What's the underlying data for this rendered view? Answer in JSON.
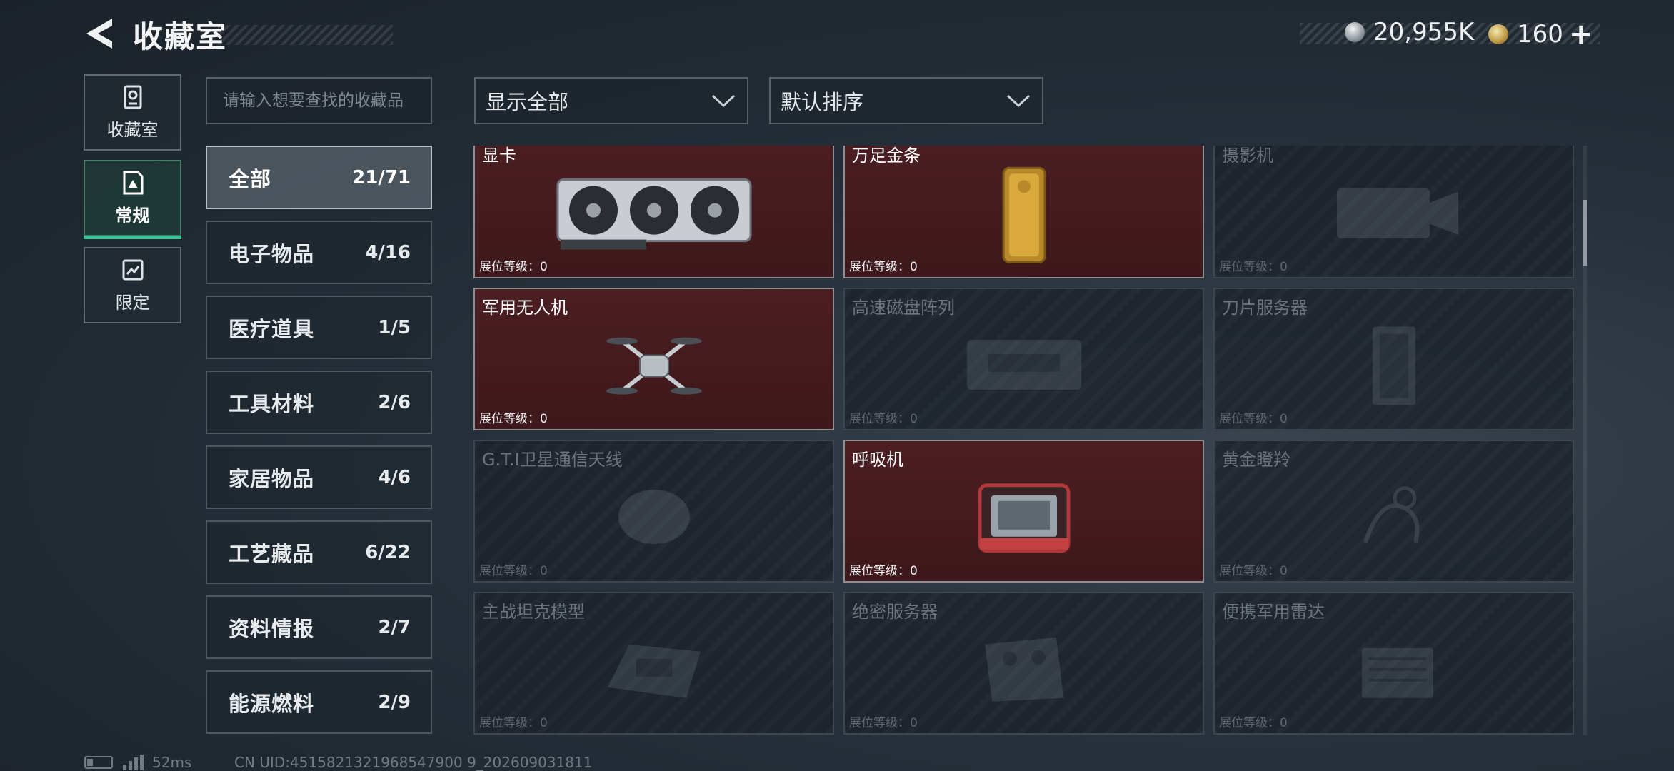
{
  "header": {
    "title": "收藏室",
    "currencies": [
      {
        "icon": "silver-coin-icon",
        "value": "20,955K"
      },
      {
        "icon": "gold-coin-icon",
        "value": "160"
      }
    ],
    "plus": "+"
  },
  "side_tabs": [
    {
      "label": "收藏室",
      "icon": "collection-icon",
      "active": false
    },
    {
      "label": "常规",
      "icon": "regular-icon",
      "active": true
    },
    {
      "label": "限定",
      "icon": "limited-icon",
      "active": false
    }
  ],
  "search": {
    "placeholder": "请输入想要查找的收藏品"
  },
  "filters": {
    "display": "显示全部",
    "sort": "默认排序"
  },
  "categories": [
    {
      "name": "全部",
      "count": "21/71",
      "active": true
    },
    {
      "name": "电子物品",
      "count": "4/16"
    },
    {
      "name": "医疗道具",
      "count": "1/5"
    },
    {
      "name": "工具材料",
      "count": "2/6"
    },
    {
      "name": "家居物品",
      "count": "4/6"
    },
    {
      "name": "工艺藏品",
      "count": "6/22"
    },
    {
      "name": "资料情报",
      "count": "2/7"
    },
    {
      "name": "能源燃料",
      "count": "2/9"
    }
  ],
  "items": [
    {
      "name": "显卡",
      "level": "展位等级：0",
      "owned": true
    },
    {
      "name": "万足金条",
      "level": "展位等级：0",
      "owned": true
    },
    {
      "name": "摄影机",
      "level": "展位等级：0",
      "owned": false
    },
    {
      "name": "军用无人机",
      "level": "展位等级：0",
      "owned": true
    },
    {
      "name": "高速磁盘阵列",
      "level": "展位等级：0",
      "owned": false
    },
    {
      "name": "刀片服务器",
      "level": "展位等级：0",
      "owned": false
    },
    {
      "name": "G.T.I卫星通信天线",
      "level": "展位等级：0",
      "owned": false
    },
    {
      "name": "呼吸机",
      "level": "展位等级：0",
      "owned": true
    },
    {
      "name": "黄金瞪羚",
      "level": "展位等级：0",
      "owned": false
    },
    {
      "name": "主战坦克模型",
      "level": "展位等级：0",
      "owned": false
    },
    {
      "name": "绝密服务器",
      "level": "展位等级：0",
      "owned": false
    },
    {
      "name": "便携军用雷达",
      "level": "展位等级：0",
      "owned": false
    }
  ],
  "footer": {
    "ping": "52ms",
    "uid": "CN UID:4515821321968547900 9_202609031811"
  },
  "colors": {
    "accent": "#3fc49a",
    "owned_bg": "#4b1e22",
    "gold_mark": "#f4c21d"
  }
}
